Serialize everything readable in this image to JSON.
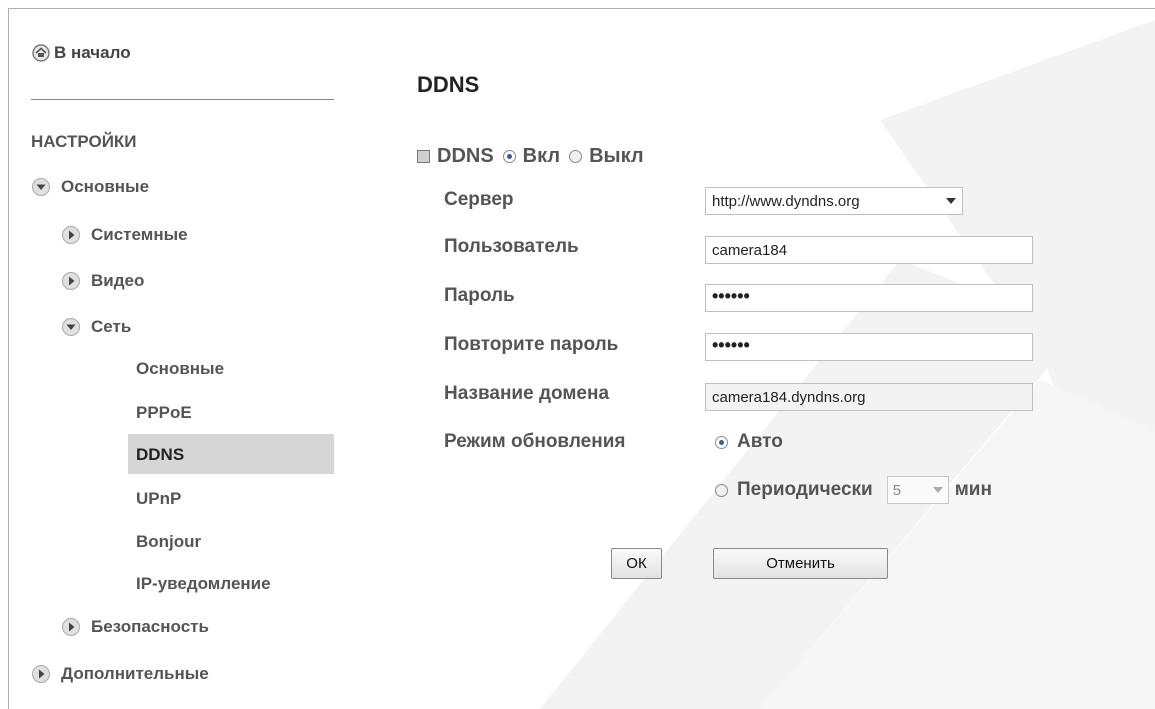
{
  "sidebar": {
    "home_label": "В начало",
    "section_title": "НАСТРОЙКИ",
    "items": {
      "basic": "Основные",
      "system": "Системные",
      "video": "Видео",
      "network": "Сеть",
      "network_basic": "Основные",
      "pppoe": "PPPoE",
      "ddns": "DDNS",
      "upnp": "UPnP",
      "bonjour": "Bonjour",
      "ip_notify": "IP-уведомление",
      "security": "Безопасность",
      "advanced": "Дополнительные"
    },
    "active_item": "DDNS"
  },
  "main": {
    "title": "DDNS",
    "ddns_label": "DDNS",
    "on_label": "Вкл",
    "off_label": "Выкл",
    "ddns_state": "on",
    "fields": {
      "server_label": "Сервер",
      "server_value": "http://www.dyndns.org",
      "user_label": "Пользователь",
      "user_value": "camera184",
      "password_label": "Пароль",
      "password_value": "••••••",
      "repeat_password_label": "Повторите пароль",
      "repeat_password_value": "••••••",
      "domain_label": "Название домена",
      "domain_value": "camera184.dyndns.org",
      "update_mode_label": "Режим обновления",
      "auto_label": "Авто",
      "periodic_label": "Периодически",
      "period_value": "5",
      "period_unit": "мин",
      "update_mode": "auto"
    },
    "buttons": {
      "ok": "ОК",
      "cancel": "Отменить"
    }
  },
  "colors": {
    "active_bg": "#d6d6d6",
    "radio_dot": "#3a5f9a",
    "watermark": "#f2f2f2"
  }
}
